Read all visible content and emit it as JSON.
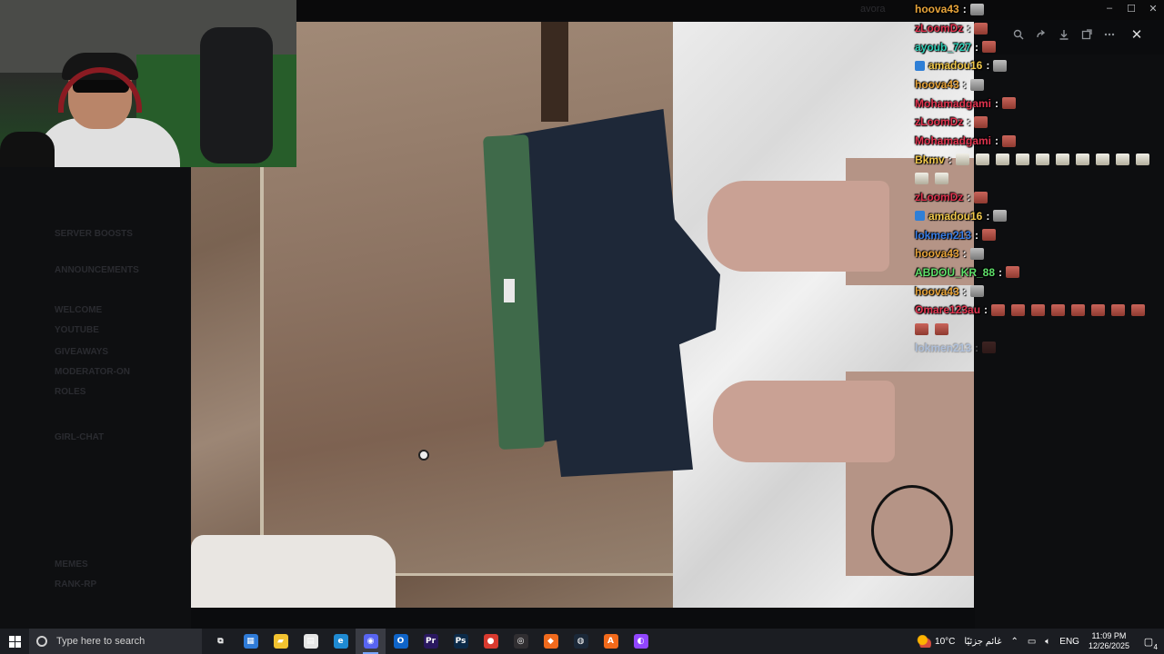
{
  "window": {
    "title": "avora",
    "minimize": "–",
    "maximize": "☐",
    "close": "✕"
  },
  "background_sidebar": [
    "SERVER BOOSTS",
    "ANNOUNCEMENTS",
    "WELCOME",
    "YOUTUBE",
    "GIVEAWAYS",
    "MODERATOR-ON",
    "ROLES",
    "GIRL-CHAT",
    "MEMES",
    "RANK-RP"
  ],
  "viewer": {
    "icons": [
      "zoom-icon",
      "forward-icon",
      "download-icon",
      "open-external-icon",
      "more-icon"
    ],
    "close_symbol": "✕"
  },
  "chat": [
    {
      "user": "hoova43",
      "color": "#e8a43a",
      "emotes": [
        "grey"
      ]
    },
    {
      "user": "zLoomDz",
      "color": "#e0344f",
      "emotes": [
        "red"
      ]
    },
    {
      "user": "ayoub_727",
      "color": "#2fd0b8",
      "emotes": [
        "red"
      ]
    },
    {
      "user": "amadou16",
      "color": "#f2c94c",
      "badge": true,
      "emotes": [
        "grey"
      ]
    },
    {
      "user": "hoova43",
      "color": "#e8a43a",
      "emotes": [
        "grey"
      ]
    },
    {
      "user": "Mohamadgami",
      "color": "#e0344f",
      "emotes": [
        "red"
      ]
    },
    {
      "user": "zLoomDz",
      "color": "#e0344f",
      "emotes": [
        "red"
      ]
    },
    {
      "user": "Mohamadgami",
      "color": "#e0344f",
      "emotes": [
        "red"
      ]
    },
    {
      "user": "Bkmv",
      "color": "#f2c94c",
      "emotes": [
        "light",
        "light",
        "light",
        "light",
        "light",
        "light",
        "light",
        "light",
        "light",
        "light"
      ]
    },
    {
      "user": "",
      "color": "#ffffff",
      "continuation": true,
      "emotes": [
        "light",
        "light"
      ]
    },
    {
      "user": "zLoomDz",
      "color": "#e0344f",
      "emotes": [
        "red"
      ]
    },
    {
      "user": "amadou16",
      "color": "#f2c94c",
      "badge": true,
      "emotes": [
        "grey"
      ]
    },
    {
      "user": "lokmen213",
      "color": "#3a7ee6",
      "emotes": [
        "red"
      ]
    },
    {
      "user": "hoova43",
      "color": "#e8a43a",
      "emotes": [
        "grey"
      ]
    },
    {
      "user": "ABDOU_KR_88",
      "color": "#5fe06a",
      "emotes": [
        "red"
      ]
    },
    {
      "user": "hoova43",
      "color": "#e8a43a",
      "emotes": [
        "grey"
      ]
    },
    {
      "user": "Omare123au",
      "color": "#e0344f",
      "emotes": [
        "red",
        "red",
        "red",
        "red",
        "red",
        "red",
        "red",
        "red"
      ]
    },
    {
      "user": "",
      "color": "#ffffff",
      "continuation": true,
      "emotes": [
        "red",
        "red"
      ]
    },
    {
      "user": "lokmen213",
      "color": "#3a7ee6",
      "dim": true,
      "emotes": [
        "red"
      ]
    }
  ],
  "taskbar": {
    "search_placeholder": "Type here to search",
    "apps": [
      {
        "name": "task-view",
        "glyph": "⧉",
        "color": "#1b1d22"
      },
      {
        "name": "microsoft-store",
        "glyph": "▦",
        "color": "#2f7bd8"
      },
      {
        "name": "file-explorer",
        "glyph": "▰",
        "color": "#f2c230"
      },
      {
        "name": "notepad",
        "glyph": "▤",
        "color": "#e6e6e6"
      },
      {
        "name": "edge",
        "glyph": "e",
        "color": "#1f8ad2"
      },
      {
        "name": "discord",
        "glyph": "◉",
        "color": "#5865f2",
        "active": true
      },
      {
        "name": "outlook",
        "glyph": "O",
        "color": "#0f64c8"
      },
      {
        "name": "premiere-pro",
        "glyph": "Pr",
        "color": "#2a1860"
      },
      {
        "name": "photoshop",
        "glyph": "Ps",
        "color": "#0c2a48"
      },
      {
        "name": "chrome",
        "glyph": "●",
        "color": "#d93a2f"
      },
      {
        "name": "obs",
        "glyph": "◎",
        "color": "#302e31"
      },
      {
        "name": "brave",
        "glyph": "◆",
        "color": "#f06a1d"
      },
      {
        "name": "steam",
        "glyph": "◍",
        "color": "#1b2838"
      },
      {
        "name": "avast",
        "glyph": "A",
        "color": "#f26a1b"
      },
      {
        "name": "twitch-studio",
        "glyph": "◐",
        "color": "#9146ff"
      }
    ],
    "weather": "10°C",
    "weather_desc": "غائم جزئيًا",
    "language": "ENG",
    "time": "11:09 PM",
    "date": "12/26/2025",
    "notifications": "4"
  }
}
